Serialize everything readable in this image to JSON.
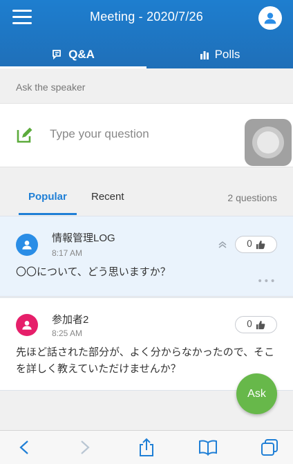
{
  "header": {
    "title": "Meeting - 2020/7/26",
    "tabs": [
      {
        "label": "Q&A",
        "icon": "chat-bubble-icon",
        "active": true
      },
      {
        "label": "Polls",
        "icon": "bar-chart-icon",
        "active": false
      }
    ]
  },
  "ask": {
    "label": "Ask the speaker",
    "placeholder": "Type your question"
  },
  "list": {
    "tabs": [
      {
        "label": "Popular",
        "active": true
      },
      {
        "label": "Recent",
        "active": false
      }
    ],
    "count_text": "2 questions"
  },
  "questions": [
    {
      "author": "情報管理LOG",
      "time": "8:17 AM",
      "text": "〇〇について、どう思いますか？",
      "likes": "0",
      "avatar_color": "#2a8de6",
      "highlighted": true
    },
    {
      "author": "参加者2",
      "time": "8:25 AM",
      "text": "先ほど話された部分が、よく分からなかったので、そこを詳しく教えていただけませんか？",
      "likes": "0",
      "avatar_color": "#e61f6a",
      "highlighted": false
    }
  ],
  "fab": {
    "label": "Ask"
  },
  "colors": {
    "header": "#1e7ecf",
    "accent": "#1f7fd6",
    "fab": "#67b84a",
    "compose_icon": "#5cab3c"
  },
  "toolbar": {
    "icons": [
      "back-icon",
      "forward-icon",
      "share-icon",
      "bookmarks-icon",
      "tabs-icon"
    ]
  }
}
